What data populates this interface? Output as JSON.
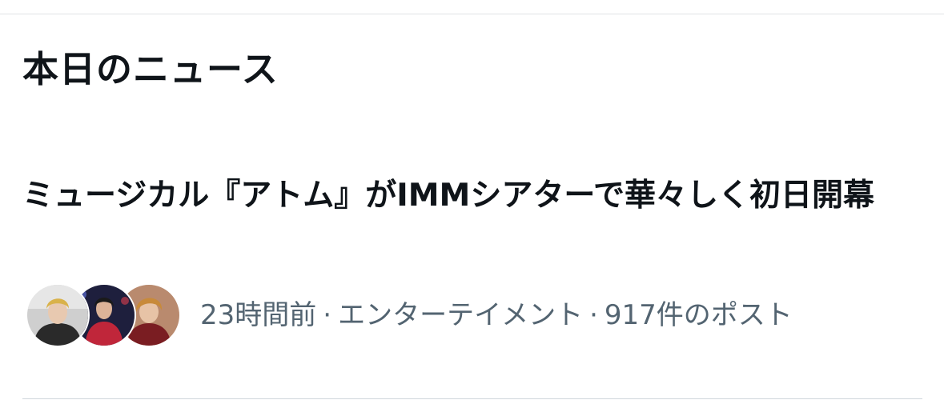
{
  "section": {
    "title": "本日のニュース"
  },
  "news_item": {
    "headline": "ミュージカル『アトム』がIMMシアターで華々しく初日開幕",
    "time": "23時間前",
    "separator": "·",
    "category": "エンターテイメント",
    "posts": "917件のポスト"
  },
  "colors": {
    "text_primary": "#0f1419",
    "text_secondary": "#536471",
    "divider": "#cfd6db",
    "background": "#ffffff"
  }
}
